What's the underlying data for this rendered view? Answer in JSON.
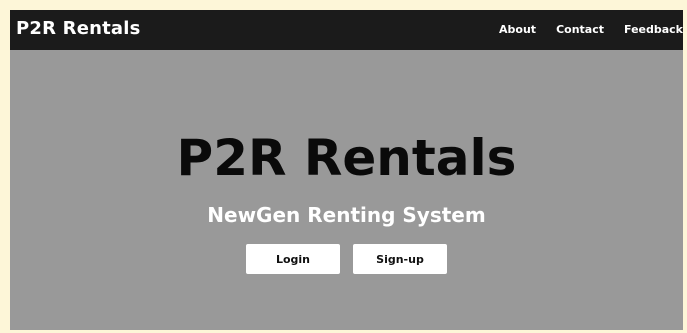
{
  "navbar": {
    "brand": "P2R Rentals",
    "links": [
      "About",
      "Contact",
      "Feedback"
    ]
  },
  "hero": {
    "title": "P2R Rentals",
    "subtitle": "NewGen Renting System",
    "login_label": "Login",
    "signup_label": "Sign-up"
  },
  "colors": {
    "navbar_bg": "#1b1b1b",
    "hero_bg": "#999999",
    "page_border": "#fdf6d8",
    "button_bg": "#ffffff"
  }
}
